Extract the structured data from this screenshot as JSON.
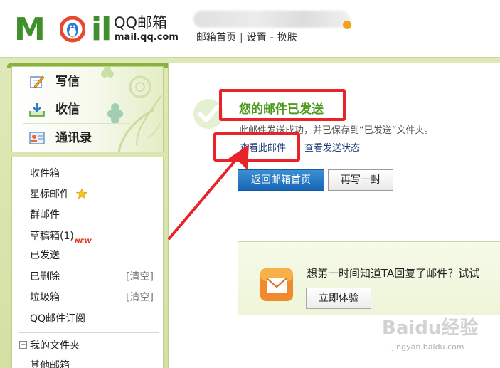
{
  "header": {
    "logo_brand": "QQ邮箱",
    "logo_domain": "mail.qq.com",
    "logo_wordmark_left": "M",
    "logo_wordmark_right": "il",
    "nav": {
      "home": "邮箱首页",
      "separator": "|",
      "settings": "设置",
      "dash": "-",
      "skin": "换肤"
    }
  },
  "sidebar": {
    "compose": {
      "label": "写信",
      "icon": "pencil-note-icon"
    },
    "inbox": {
      "label": "收信",
      "icon": "download-tray-icon"
    },
    "contacts": {
      "label": "通讯录",
      "icon": "contact-card-icon"
    },
    "folders": [
      {
        "label": "收件箱"
      },
      {
        "label": "星标邮件",
        "icon": "star-icon"
      },
      {
        "label": "群邮件"
      },
      {
        "label": "草稿箱(1)",
        "badge": "NEW"
      },
      {
        "label": "已发送"
      },
      {
        "label": "已删除",
        "action": "[清空]"
      },
      {
        "label": "垃圾箱",
        "action": "[清空]"
      },
      {
        "label": "QQ邮件订阅"
      }
    ],
    "my_folders": "我的文件夹",
    "expand_symbol": "+",
    "other_mailbox": "其他邮箱"
  },
  "main": {
    "title": "您的邮件已发送",
    "description": "此邮件发送成功，并已保存到“已发送”文件夹。",
    "view_link": "查看此邮件",
    "status_link": "查看发送状态",
    "back_button": "返回邮箱首页",
    "rewrite_button": "再写一封",
    "promo": {
      "text": "想第一时间知道TA回复了邮件？试试",
      "button": "立即体验",
      "icon": "mail-envelope-icon"
    }
  },
  "watermark": {
    "brand": "Baidu经验",
    "url": "jingyan.baidu.com"
  },
  "colors": {
    "brand_green": "#3f8f2a",
    "title_green": "#4d9a1f",
    "primary_blue": "#1766b8",
    "annotation_red": "#e8232a",
    "link_blue": "#1f3f7a"
  }
}
